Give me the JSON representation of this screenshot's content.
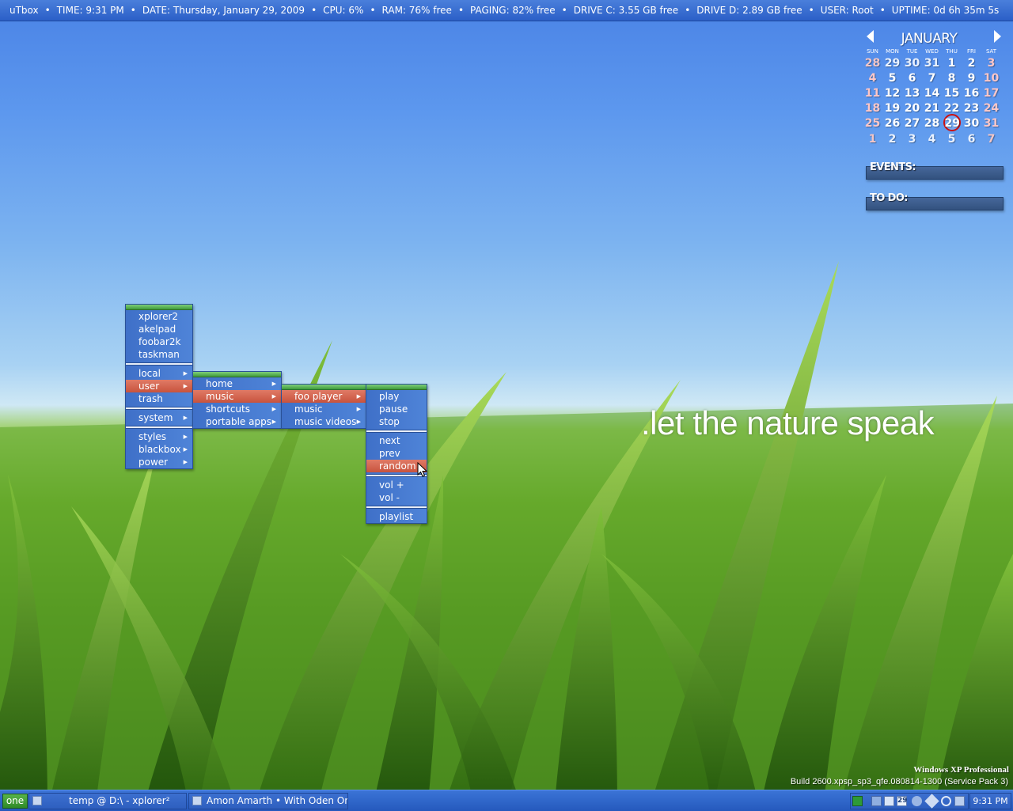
{
  "topbar": {
    "items": [
      "uTbox",
      "TIME: 9:31 PM",
      "DATE: Thursday, January 29, 2009",
      "CPU: 6%",
      "RAM: 76% free",
      "PAGING: 82% free",
      "DRIVE C: 3.55 GB free",
      "DRIVE D: 2.89 GB free",
      "USER: Root",
      "UPTIME: 0d  6h 35m  5s"
    ],
    "separator": "•"
  },
  "slogan": ".let the nature speak",
  "calendar": {
    "month": "JANUARY",
    "weekdays": [
      "SUN",
      "MON",
      "TUE",
      "WED",
      "THU",
      "FRI",
      "SAT"
    ],
    "weeks": [
      [
        "28",
        "29",
        "30",
        "31",
        "1",
        "2",
        "3"
      ],
      [
        "4",
        "5",
        "6",
        "7",
        "8",
        "9",
        "10"
      ],
      [
        "11",
        "12",
        "13",
        "14",
        "15",
        "16",
        "17"
      ],
      [
        "18",
        "19",
        "20",
        "21",
        "22",
        "23",
        "24"
      ],
      [
        "25",
        "26",
        "27",
        "28",
        "29",
        "30",
        "31"
      ],
      [
        "1",
        "2",
        "3",
        "4",
        "5",
        "6",
        "7"
      ]
    ],
    "today": "29",
    "events_label": "EVENTS:",
    "todo_label": "TO DO:"
  },
  "menus": {
    "root": {
      "items": [
        {
          "label": "xplorer2"
        },
        {
          "label": "akelpad"
        },
        {
          "label": "foobar2k"
        },
        {
          "label": "taskman"
        },
        {
          "sep": true
        },
        {
          "label": "local",
          "sub": true
        },
        {
          "label": "user",
          "sub": true,
          "selected": true
        },
        {
          "label": "trash"
        },
        {
          "sep": true
        },
        {
          "label": "system",
          "sub": true
        },
        {
          "sep": true
        },
        {
          "label": "styles",
          "sub": true
        },
        {
          "label": "blackbox",
          "sub": true
        },
        {
          "label": "power",
          "sub": true
        }
      ]
    },
    "user": {
      "items": [
        {
          "label": "home",
          "sub": true
        },
        {
          "label": "music",
          "sub": true,
          "selected": true
        },
        {
          "label": "shortcuts",
          "sub": true
        },
        {
          "label": "portable apps",
          "sub": true
        }
      ]
    },
    "music": {
      "items": [
        {
          "label": "foo player",
          "sub": true,
          "selected": true
        },
        {
          "label": "music",
          "sub": true
        },
        {
          "label": "music videos",
          "sub": true
        }
      ]
    },
    "foo_player": {
      "items": [
        {
          "label": "play"
        },
        {
          "label": "pause"
        },
        {
          "label": "stop"
        },
        {
          "sep": true
        },
        {
          "label": "next"
        },
        {
          "label": "prev"
        },
        {
          "label": "random",
          "selected": true
        },
        {
          "sep": true
        },
        {
          "label": "vol +"
        },
        {
          "label": "vol -"
        },
        {
          "sep": true
        },
        {
          "label": "playlist"
        }
      ]
    }
  },
  "watermark": {
    "line1": "Windows XP Professional",
    "line2": "Build 2600.xpsp_sp3_qfe.080814-1300 (Service Pack 3)"
  },
  "taskbar": {
    "workspace": "one",
    "tasks": [
      {
        "label": "temp @ D:\\ - xplorer²"
      },
      {
        "label": "Amon Amarth • With Oden On ..."
      }
    ],
    "clock": "9:31 PM",
    "tray_date_badge": "29"
  },
  "colors": {
    "menu_bg": "#4a7ed4",
    "menu_selected": "#d2614b",
    "menu_titlebar": "#5cb556",
    "bar_blue": "#2b5fc7",
    "today_ring": "#cc1010"
  }
}
